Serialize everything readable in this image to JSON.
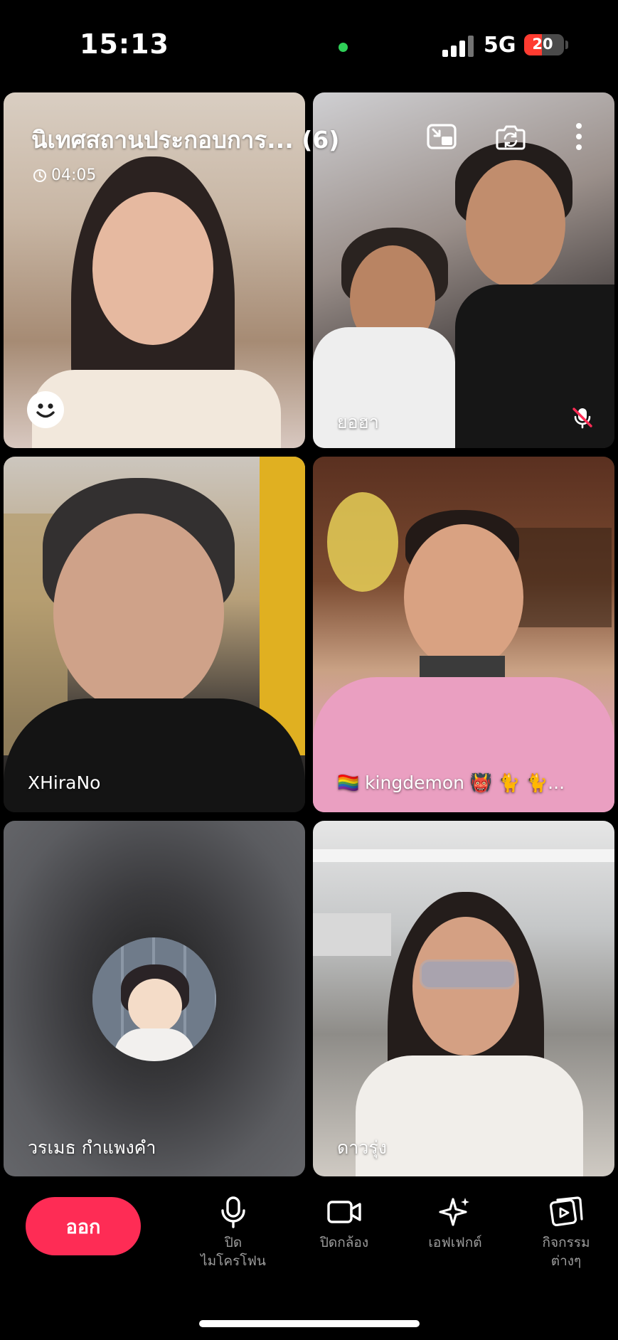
{
  "status_bar": {
    "time": "15:13",
    "network": "5G",
    "battery": "20"
  },
  "call": {
    "title": "นิเทศสถานประกอบการ... (6)",
    "timer": "04:05"
  },
  "participants": [
    {
      "name": ""
    },
    {
      "name": "ยอฮา"
    },
    {
      "name": "XHiraNo"
    },
    {
      "name": "🏳️‍🌈 kingdemon 👹 🐈 🐈..."
    },
    {
      "name": "วรเมธ กำแพงคำ"
    },
    {
      "name": "ดาวรุ่ง"
    }
  ],
  "controls": {
    "leave": "ออก",
    "mic": "ปิด\nไมโครโฟน",
    "camera": "ปิดกล้อง",
    "effects": "เอฟเฟกต์",
    "activities": "กิจกรรม\nต่างๆ"
  },
  "colors": {
    "leave_button": "#fe2c55",
    "status_green": "#2fd058",
    "battery_low": "#ff3b30"
  }
}
